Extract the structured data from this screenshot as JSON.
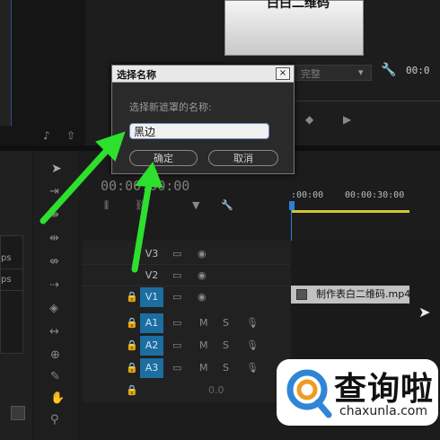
{
  "colors": {
    "accent": "#1c6da0",
    "arrow": "#2ee02e",
    "playhead": "#2f7fd6"
  },
  "top_preview": {
    "text": "白白二维码"
  },
  "playback": {
    "dropdown_value": "完整",
    "timecode": "00:0"
  },
  "timeline": {
    "current_timecode": "00:00:00:00",
    "ruler_start": ":00:00",
    "ruler_mark": "00:00:30:00",
    "tracks_video": [
      "V3",
      "V2",
      "V1"
    ],
    "tracks_audio": [
      "A1",
      "A2",
      "A3"
    ],
    "mute_label": "M",
    "solo_label": "S",
    "master_value": "0.0",
    "clip_name": "制作表白二维码.mp4"
  },
  "project_panel": {
    "fps_items": [
      "ps",
      "ps"
    ]
  },
  "dialog": {
    "title": "选择名称",
    "close": "×",
    "prompt": "选择新遮罩的名称:",
    "input_value": "黑边",
    "ok_label": "确定",
    "cancel_label": "取消"
  },
  "watermark": {
    "main": "查询啦",
    "sub": "chaxunla.com"
  }
}
